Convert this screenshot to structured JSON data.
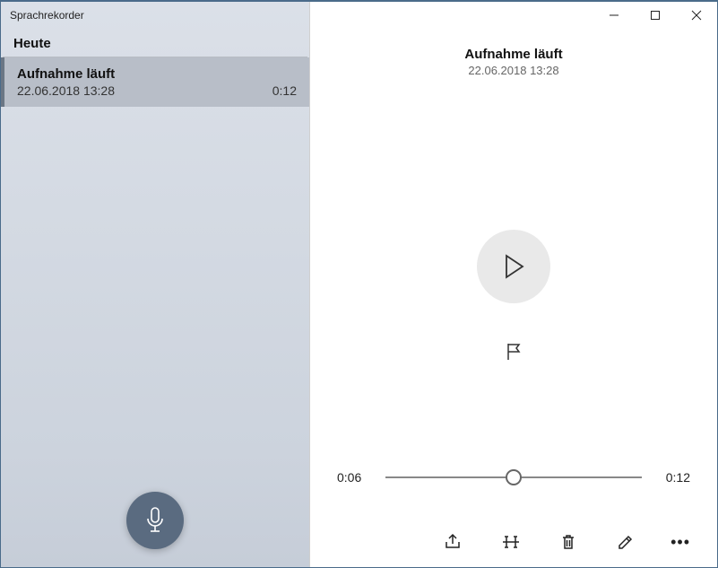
{
  "app_title": "Sprachrekorder",
  "sidebar": {
    "section_header": "Heute",
    "items": [
      {
        "title": "Aufnahme läuft",
        "datetime": "22.06.2018 13:28",
        "duration": "0:12",
        "selected": true
      }
    ]
  },
  "recording": {
    "title": "Aufnahme läuft",
    "datetime": "22.06.2018 13:28"
  },
  "timeline": {
    "current": "0:06",
    "total": "0:12",
    "position_percent": 50
  },
  "icons": {
    "record": "microphone-icon",
    "play": "play-icon",
    "flag": "flag-icon",
    "share": "share-icon",
    "trim": "trim-icon",
    "delete": "trash-icon",
    "rename": "pencil-icon",
    "more": "more-icon",
    "minimize": "minimize-icon",
    "maximize": "maximize-icon",
    "close": "close-icon"
  }
}
